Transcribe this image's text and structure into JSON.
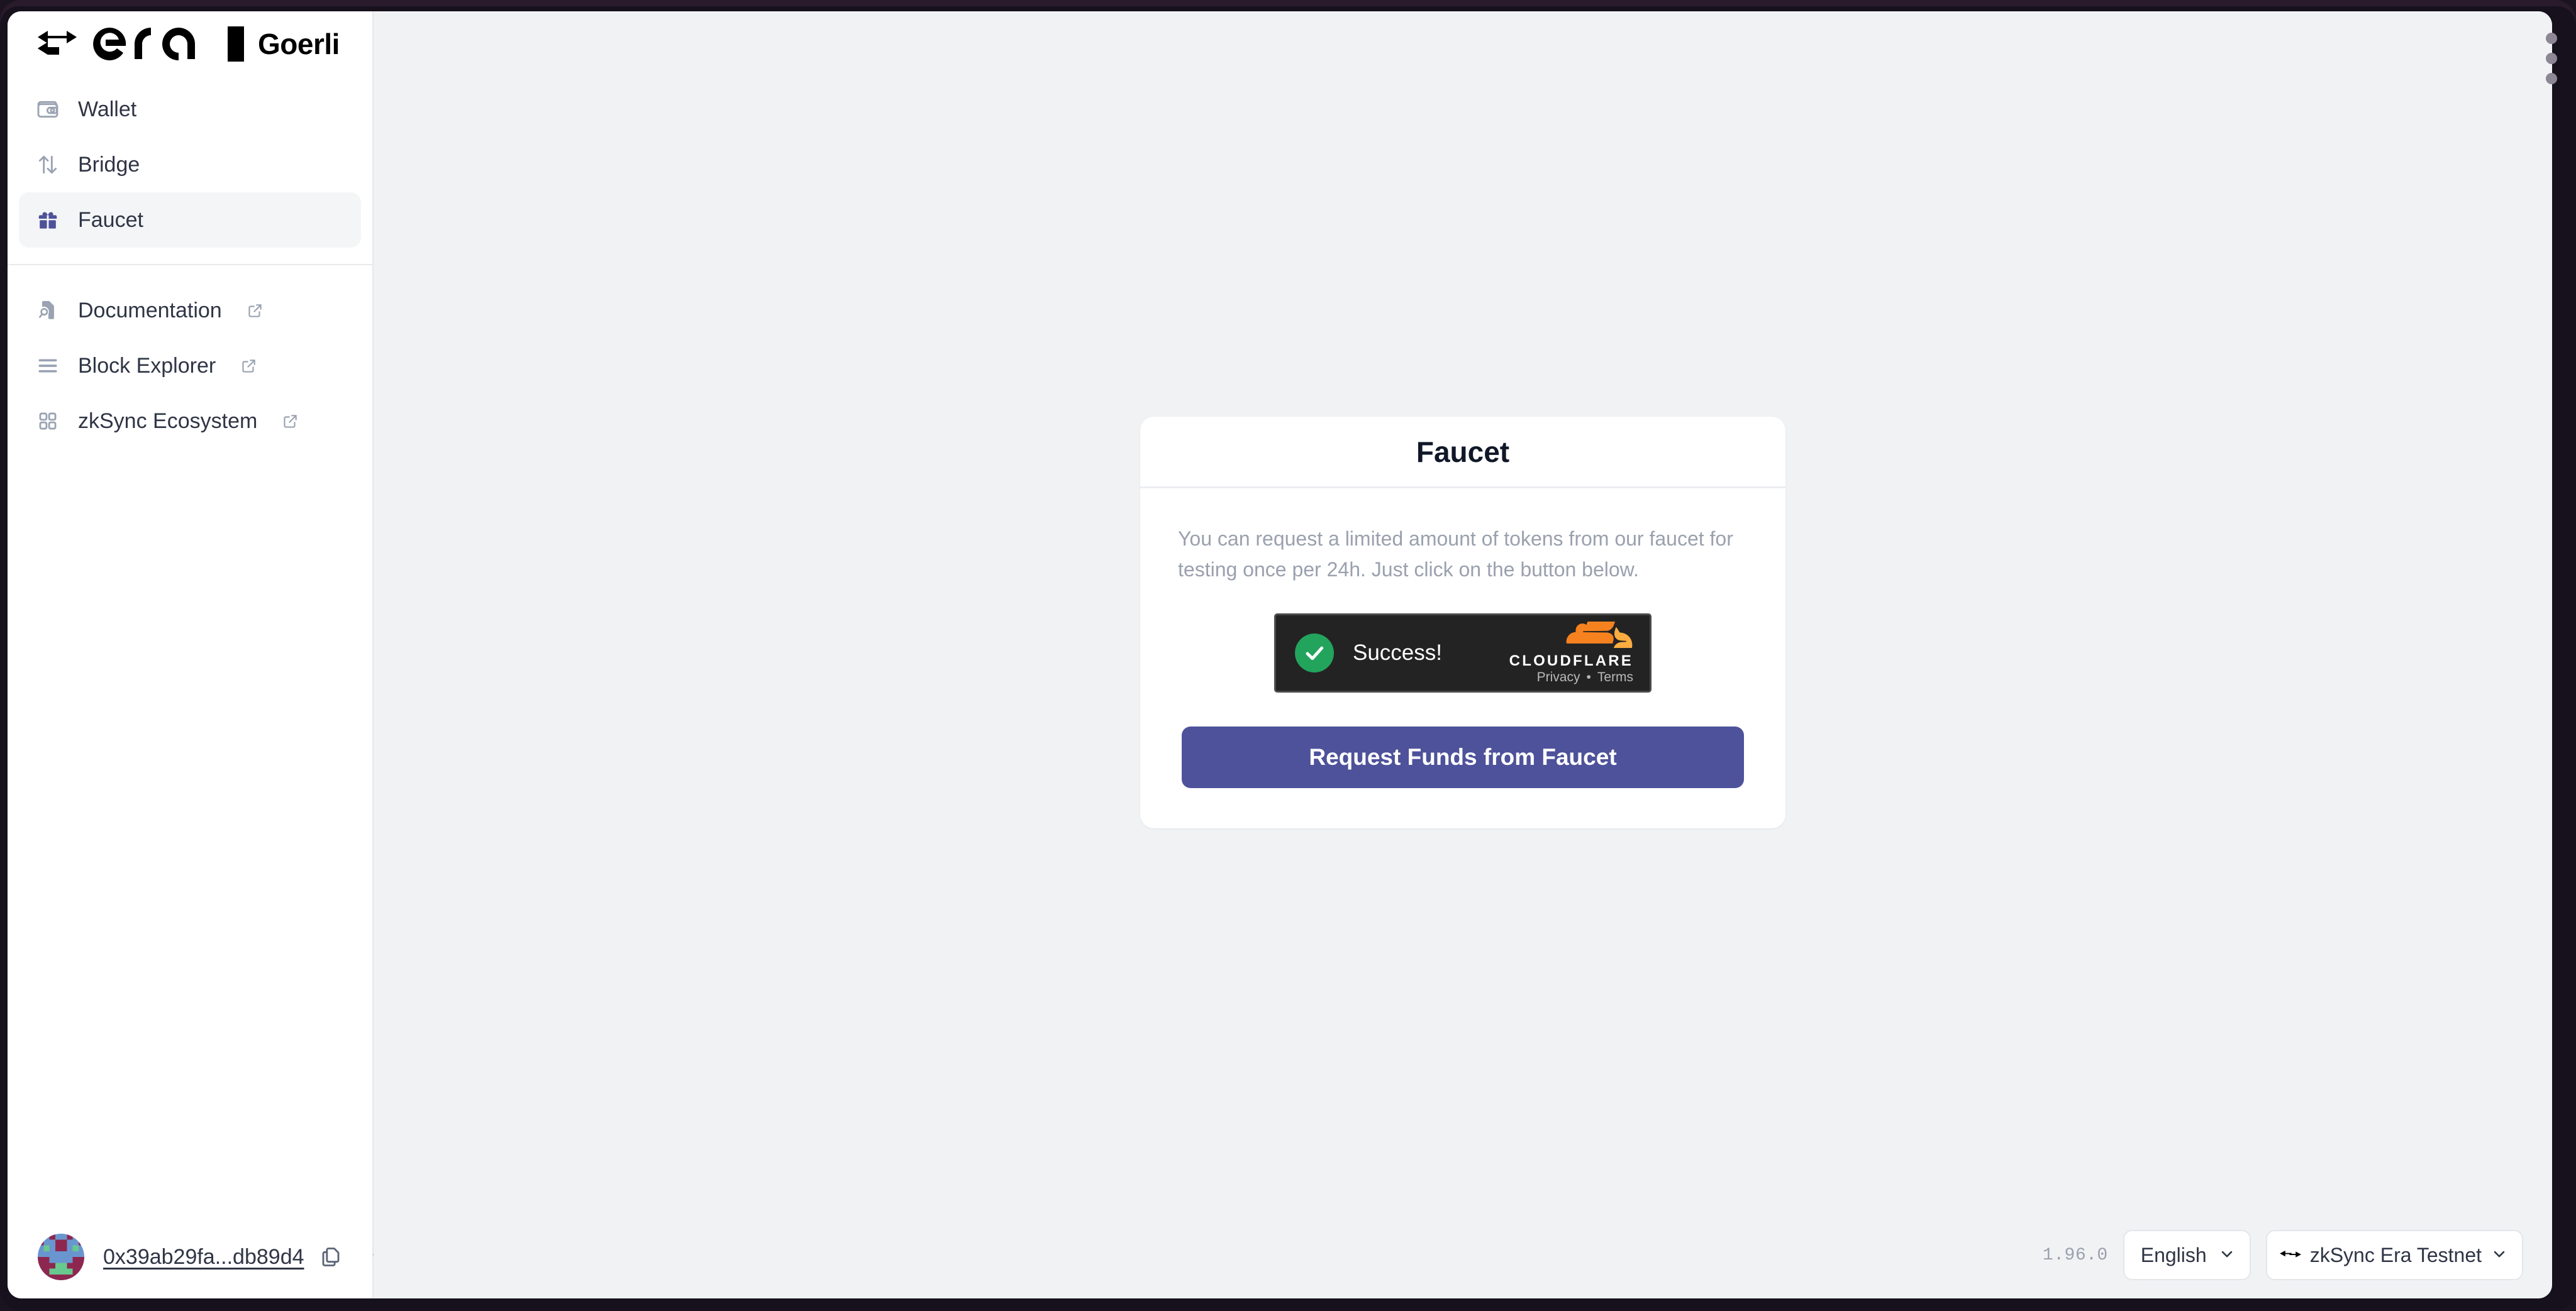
{
  "brand": {
    "logo_icon": "zksync-era-arrows-logo",
    "wordmark": "era",
    "network_badge": "Goerli"
  },
  "sidebar": {
    "primary_items": [
      {
        "id": "wallet",
        "label": "Wallet",
        "icon": "wallet-icon",
        "active": false,
        "external": false
      },
      {
        "id": "bridge",
        "label": "Bridge",
        "icon": "arrows-up-down-icon",
        "active": false,
        "external": false
      },
      {
        "id": "faucet",
        "label": "Faucet",
        "icon": "gift-icon",
        "active": true,
        "external": false
      }
    ],
    "secondary_items": [
      {
        "id": "documentation",
        "label": "Documentation",
        "icon": "document-search-icon",
        "external": true
      },
      {
        "id": "block-explorer",
        "label": "Block Explorer",
        "icon": "list-lines-icon",
        "external": true
      },
      {
        "id": "zksync-ecosystem",
        "label": "zkSync Ecosystem",
        "icon": "grid-squares-icon",
        "external": true
      }
    ],
    "account": {
      "avatar_icon": "blockie-avatar",
      "address": "0x39ab29fa...db89d4",
      "copy_icon": "copy-icon",
      "expand_icon": "chevron-down-icon"
    }
  },
  "main": {
    "card": {
      "title": "Faucet",
      "description": "You can request a limited amount of tokens from our faucet for testing once per 24h. Just click on the button below.",
      "captcha": {
        "provider": "Cloudflare Turnstile",
        "status_icon": "green-check-icon",
        "status_text": "Success!",
        "brand_name": "CLOUDFLARE",
        "privacy_label": "Privacy",
        "separator": "•",
        "terms_label": "Terms"
      },
      "submit_label": "Request Funds from Faucet"
    }
  },
  "footer": {
    "version": "1.96.0",
    "language": {
      "value": "English",
      "chevron_icon": "chevron-down-icon"
    },
    "network": {
      "logo_icon": "zksync-era-arrows-logo",
      "value": "zkSync Era Testnet",
      "chevron_icon": "chevron-down-icon"
    }
  },
  "window": {
    "menu_icon": "three-dots-vertical-icon"
  },
  "colors": {
    "accent": "#4e529a",
    "page_bg": "#f1f2f4",
    "frame": "#2a1b2c",
    "success_green": "#22a45d",
    "cloudflare_orange": "#f6821f",
    "muted_text": "#9aa1ae"
  }
}
